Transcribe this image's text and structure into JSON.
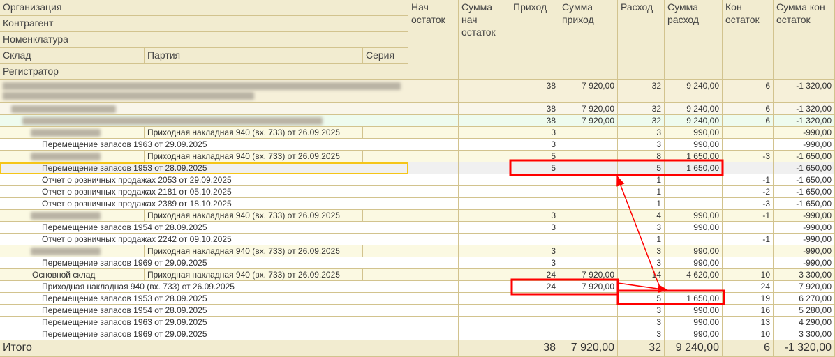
{
  "header": {
    "organization": "Организация",
    "counterparty": "Контрагент",
    "nomenclature": "Номенклатура",
    "warehouse": "Склад",
    "batch": "Партия",
    "series": "Серия",
    "registrar": "Регистратор",
    "columns": [
      "Нач остаток",
      "Сумма нач остаток",
      "Приход",
      "Сумма приход",
      "Расход",
      "Сумма расход",
      "Кон остаток",
      "Сумма кон остаток"
    ]
  },
  "colors": {
    "header_bg": "#f2ecd0",
    "group_bg": "#fbf9e2",
    "green_bg": "#eefbee",
    "selected_bg": "#f0f0f0",
    "selection_border": "#f5c518",
    "annotation": "#ff0000"
  },
  "rows": [
    {
      "type": "org",
      "text": "",
      "vals": [
        "",
        "",
        "38",
        "7 920,00",
        "32",
        "9 240,00",
        "6",
        "-1 320,00"
      ]
    },
    {
      "type": "counterparty",
      "text": "",
      "vals": [
        "",
        "",
        "38",
        "7 920,00",
        "32",
        "9 240,00",
        "6",
        "-1 320,00"
      ]
    },
    {
      "type": "nomenclature",
      "text": "",
      "vals": [
        "",
        "",
        "38",
        "7 920,00",
        "32",
        "9 240,00",
        "6",
        "-1 320,00"
      ]
    },
    {
      "type": "batch",
      "text": "",
      "batch": "Приходная накладная 940  (вх. 733) от 26.09.2025",
      "vals": [
        "",
        "",
        "3",
        "",
        "3",
        "990,00",
        "",
        "-990,00"
      ]
    },
    {
      "type": "doc",
      "text": "Перемещение запасов 1963 от 29.09.2025",
      "vals": [
        "",
        "",
        "3",
        "",
        "3",
        "990,00",
        "",
        "-990,00"
      ]
    },
    {
      "type": "batch",
      "text": "",
      "batch": "Приходная накладная 940  (вх. 733) от 26.09.2025",
      "vals": [
        "",
        "",
        "5",
        "",
        "8",
        "1 650,00",
        "-3",
        "-1 650,00"
      ]
    },
    {
      "type": "doc",
      "selected": true,
      "text": "Перемещение запасов 1953 от 28.09.2025",
      "vals": [
        "",
        "",
        "5",
        "",
        "5",
        "1 650,00",
        "",
        "-1 650,00"
      ]
    },
    {
      "type": "doc",
      "text": "Отчет о розничных продажах 2053 от 29.09.2025",
      "vals": [
        "",
        "",
        "",
        "",
        "1",
        "",
        "-1",
        "-1 650,00"
      ]
    },
    {
      "type": "doc",
      "text": "Отчет о розничных продажах 2181 от 05.10.2025",
      "vals": [
        "",
        "",
        "",
        "",
        "1",
        "",
        "-2",
        "-1 650,00"
      ]
    },
    {
      "type": "doc",
      "text": "Отчет о розничных продажах 2389 от 18.10.2025",
      "vals": [
        "",
        "",
        "",
        "",
        "1",
        "",
        "-3",
        "-1 650,00"
      ]
    },
    {
      "type": "batch",
      "text": "",
      "batch": "Приходная накладная 940  (вх. 733) от 26.09.2025",
      "vals": [
        "",
        "",
        "3",
        "",
        "4",
        "990,00",
        "-1",
        "-990,00"
      ]
    },
    {
      "type": "doc",
      "text": "Перемещение запасов 1954 от 28.09.2025",
      "vals": [
        "",
        "",
        "3",
        "",
        "3",
        "990,00",
        "",
        "-990,00"
      ]
    },
    {
      "type": "doc",
      "text": "Отчет о розничных продажах 2242 от 09.10.2025",
      "vals": [
        "",
        "",
        "",
        "",
        "1",
        "",
        "-1",
        "-990,00"
      ]
    },
    {
      "type": "batch",
      "text": "",
      "batch": "Приходная накладная 940  (вх. 733) от 26.09.2025",
      "vals": [
        "",
        "",
        "3",
        "",
        "3",
        "990,00",
        "",
        "-990,00"
      ]
    },
    {
      "type": "doc",
      "text": "Перемещение запасов 1969 от 29.09.2025",
      "vals": [
        "",
        "",
        "3",
        "",
        "3",
        "990,00",
        "",
        "-990,00"
      ]
    },
    {
      "type": "batch",
      "text": "Основной склад",
      "batch": "Приходная накладная 940  (вх. 733) от 26.09.2025",
      "vals": [
        "",
        "",
        "24",
        "7 920,00",
        "14",
        "4 620,00",
        "10",
        "3 300,00"
      ]
    },
    {
      "type": "doc",
      "text": "Приходная накладная 940  (вх. 733) от 26.09.2025",
      "vals": [
        "",
        "",
        "24",
        "7 920,00",
        "",
        "",
        "24",
        "7 920,00"
      ]
    },
    {
      "type": "doc",
      "text": "Перемещение запасов 1953 от 28.09.2025",
      "vals": [
        "",
        "",
        "",
        "",
        "5",
        "1 650,00",
        "19",
        "6 270,00"
      ]
    },
    {
      "type": "doc",
      "text": "Перемещение запасов 1954 от 28.09.2025",
      "vals": [
        "",
        "",
        "",
        "",
        "3",
        "990,00",
        "16",
        "5 280,00"
      ]
    },
    {
      "type": "doc",
      "text": "Перемещение запасов 1963 от 29.09.2025",
      "vals": [
        "",
        "",
        "",
        "",
        "3",
        "990,00",
        "13",
        "4 290,00"
      ]
    },
    {
      "type": "doc",
      "text": "Перемещение запасов 1969 от 29.09.2025",
      "vals": [
        "",
        "",
        "",
        "",
        "3",
        "990,00",
        "10",
        "3 300,00"
      ]
    }
  ],
  "total": {
    "label": "Итого",
    "vals": [
      "",
      "",
      "38",
      "7 920,00",
      "32",
      "9 240,00",
      "6",
      "-1 320,00"
    ]
  }
}
